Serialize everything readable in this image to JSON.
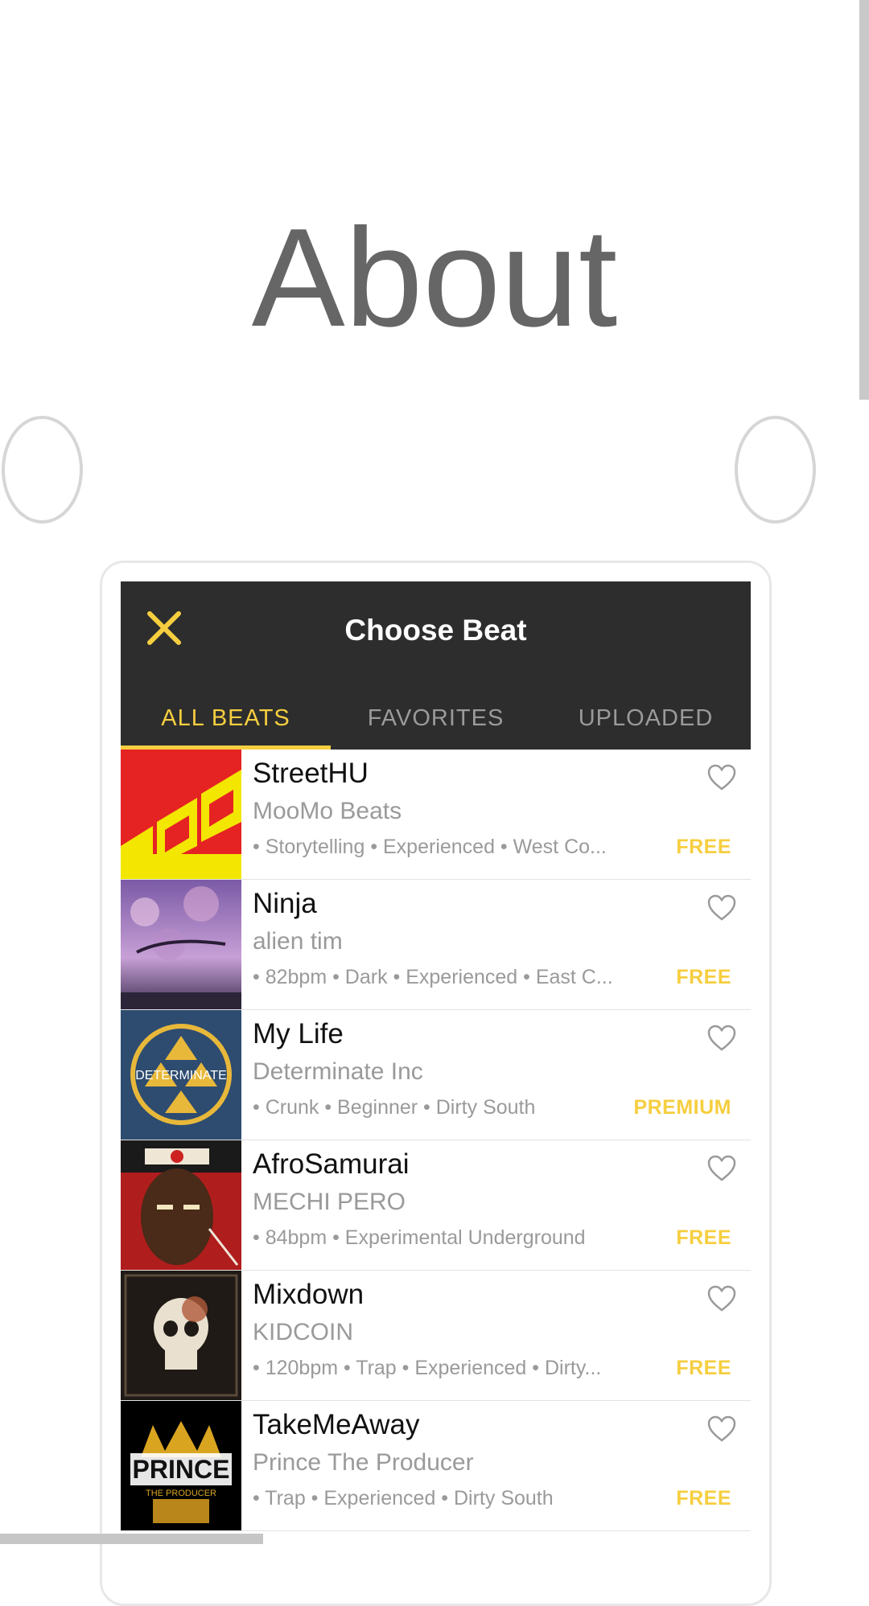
{
  "page": {
    "title": "About"
  },
  "app": {
    "header_title": "Choose Beat",
    "close_label": "",
    "tabs": [
      {
        "label": "ALL BEATS",
        "active": true
      },
      {
        "label": "FAVORITES",
        "active": false
      },
      {
        "label": "UPLOADED",
        "active": false
      }
    ],
    "accent_color": "#f6ce3f",
    "header_color": "#2d2d2d"
  },
  "beats": [
    {
      "title": "StreetHU",
      "artist": "MooMo Beats",
      "tags": "• Storytelling • Experienced • West Co...",
      "price": "FREE",
      "art_icon": "moomo-cover-art"
    },
    {
      "title": "Ninja",
      "artist": "alien tim",
      "tags": "• 82bpm • Dark • Experienced • East C...",
      "price": "FREE",
      "art_icon": "ninja-cover-art"
    },
    {
      "title": "My Life",
      "artist": "Determinate Inc",
      "tags": "• Crunk • Beginner • Dirty South",
      "price": "PREMIUM",
      "art_icon": "determinate-cover-art",
      "art_text": "DETERMINATE"
    },
    {
      "title": "AfroSamurai",
      "artist": "MECHI PERO",
      "tags": "• 84bpm • Experimental Underground",
      "price": "FREE",
      "art_icon": "afro-samurai-cover-art"
    },
    {
      "title": "Mixdown",
      "artist": "KIDCOIN",
      "tags": "• 120bpm • Trap • Experienced • Dirty...",
      "price": "FREE",
      "art_icon": "skull-cover-art"
    },
    {
      "title": "TakeMeAway",
      "artist": "Prince The Producer",
      "tags": "• Trap • Experienced • Dirty South",
      "price": "FREE",
      "art_icon": "prince-cover-art",
      "art_text": "PRINCE",
      "art_subtext": "THE PRODUCER"
    }
  ]
}
